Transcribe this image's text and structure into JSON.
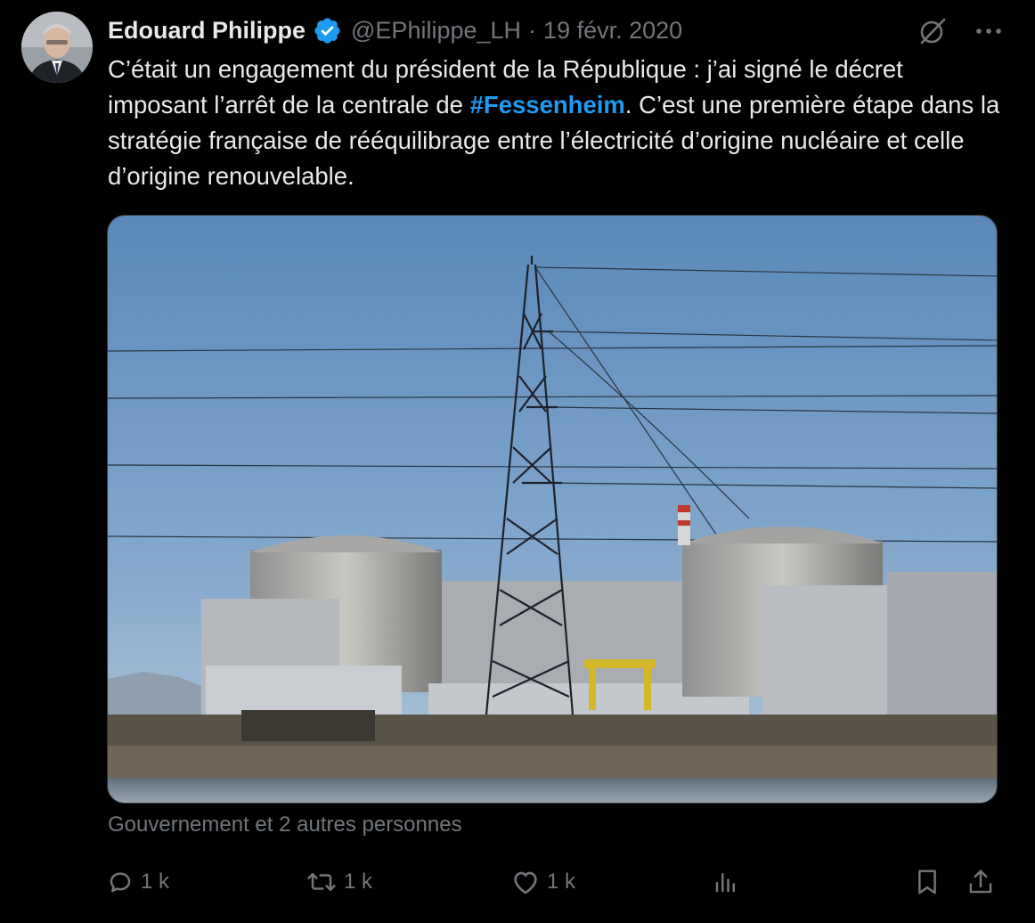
{
  "author": {
    "name": "Edouard Philippe",
    "handle": "@EPhilippe_LH",
    "separator": "·",
    "date": "19 févr. 2020"
  },
  "tweet": {
    "text_before": "C’était un engagement du président de la République : j’ai signé le décret imposant l’arrêt de la centrale de ",
    "hashtag": "#Fessenheim",
    "text_after": ". C’est une première étape dans la stratégie française de rééquilibrage entre l’électricité d’origine nucléaire et celle d’origine renouvelable."
  },
  "social_context": "Gouvernement et 2 autres personnes",
  "actions": {
    "reply_count": "1 k",
    "retweet_count": "1 k",
    "like_count": "1 k"
  },
  "colors": {
    "background": "#000000",
    "text": "#e7e9ea",
    "muted": "#71767b",
    "accent": "#1d9bf0"
  },
  "icons": {
    "verified": "verified-badge-icon",
    "grok": "grok-icon",
    "more": "more-icon",
    "reply": "reply-icon",
    "retweet": "retweet-icon",
    "like": "like-icon",
    "views": "views-icon",
    "bookmark": "bookmark-icon",
    "share": "share-icon"
  }
}
